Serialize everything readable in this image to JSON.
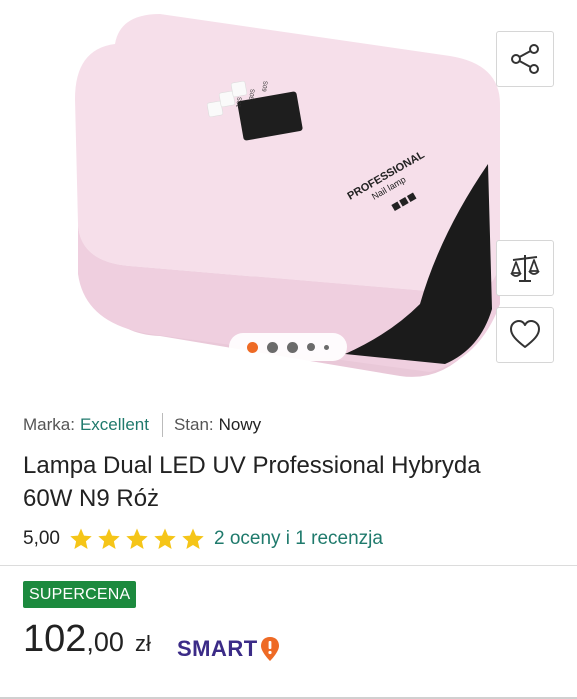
{
  "product": {
    "brand_label": "Marka:",
    "brand": "Excellent",
    "condition_label": "Stan:",
    "condition": "Nowy",
    "title": "Lampa Dual LED UV Professional Hybryda 60W N9 Róż",
    "image_text": {
      "line1": "PROFESSIONAL",
      "line2": "Nail lamp",
      "btn1": "10S",
      "btn2": "30S",
      "btn3": "60S"
    }
  },
  "rating": {
    "score": "5,00",
    "stars": 5,
    "reviews_link": "2 oceny i 1 recenzja"
  },
  "offer": {
    "badge": "SUPERCENA",
    "price_integer": "102",
    "price_decimal": ",00",
    "currency": "zł",
    "smart_label": "SMART"
  },
  "gallery": {
    "image_count": 5,
    "active_index": 0
  },
  "actions": [
    "share-icon",
    "compare-scale-icon",
    "heart-icon"
  ],
  "colors": {
    "link": "#1f7a6c",
    "star": "#f5c518",
    "badge_bg": "#1c8a3e",
    "smart": "#3b2b87",
    "smart_icon": "#ee6a25",
    "dot_active": "#ee6a25",
    "lamp_body": "#f4d9e6"
  }
}
